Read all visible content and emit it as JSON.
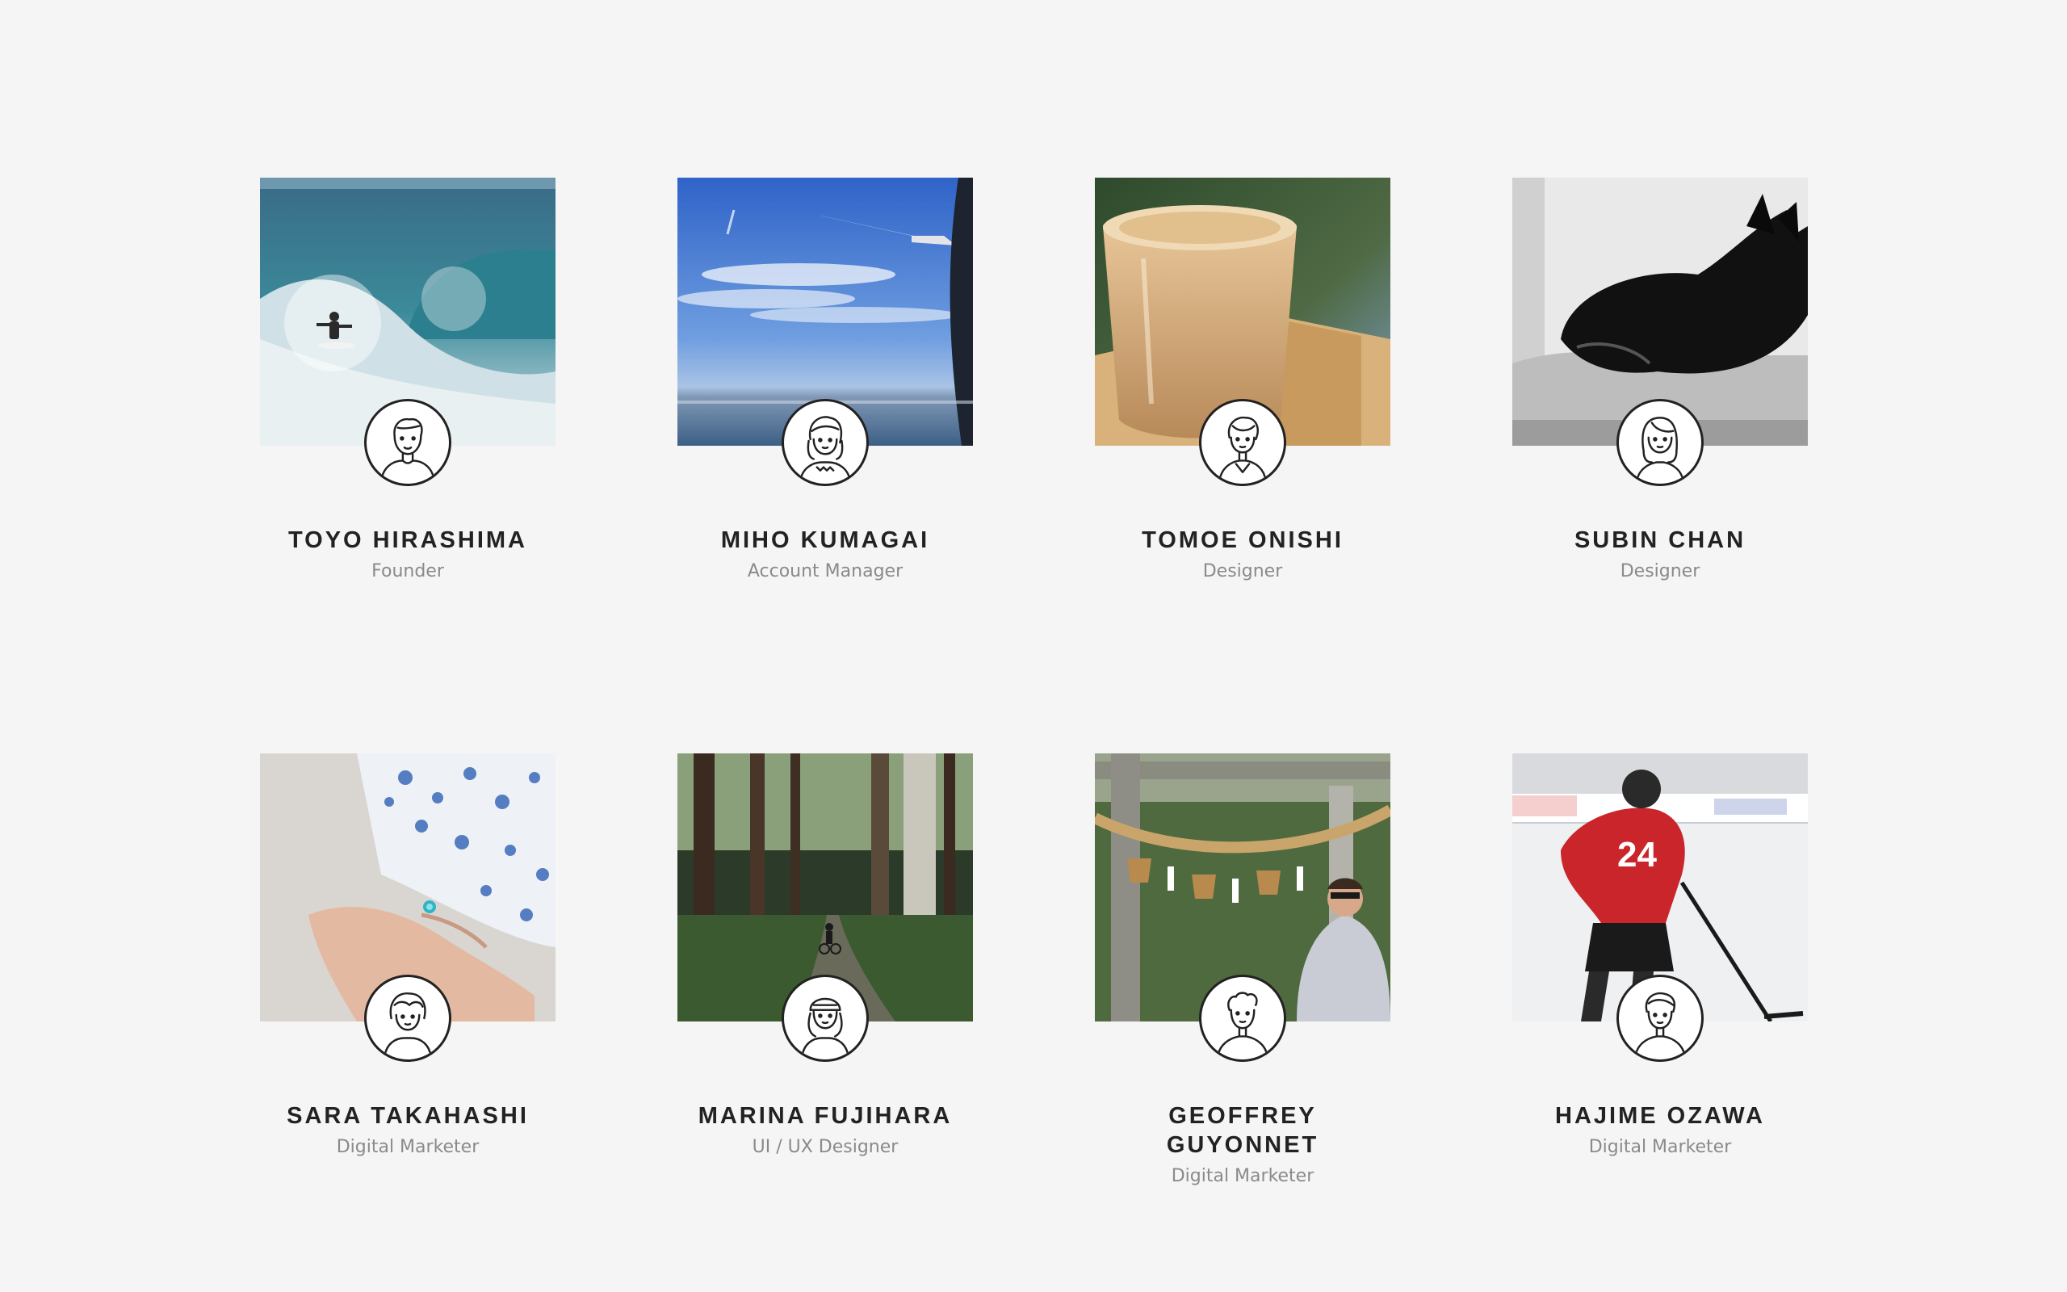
{
  "team": {
    "members": [
      {
        "name": "TOYO HIRASHIMA",
        "role": "Founder",
        "photo": "surfing-wave-photo",
        "avatar": "man-short-hair-avatar-icon"
      },
      {
        "name": "MIHO KUMAGAI",
        "role": "Account Manager",
        "photo": "airplane-window-sky-photo",
        "avatar": "woman-bangs-avatar-icon"
      },
      {
        "name": "TOMOE ONISHI",
        "role": "Designer",
        "photo": "sake-glass-masu-photo",
        "avatar": "woman-short-hair-avatar-icon"
      },
      {
        "name": "SUBIN CHAN",
        "role": "Designer",
        "photo": "black-dog-bw-photo",
        "avatar": "woman-long-hair-avatar-icon"
      },
      {
        "name": "SARA TAKAHASHI",
        "role": "Digital Marketer",
        "photo": "hand-ring-fabric-photo",
        "avatar": "woman-wavy-hair-avatar-icon"
      },
      {
        "name": "MARINA FUJIHARA",
        "role": "UI / UX Designer",
        "photo": "forest-path-cyclist-photo",
        "avatar": "woman-beanie-avatar-icon"
      },
      {
        "name": "GEOFFREY GUYONNET",
        "role": "Digital Marketer",
        "photo": "shrine-torii-rope-photo",
        "avatar": "man-curly-hair-avatar-icon"
      },
      {
        "name": "HAJIME OZAWA",
        "role": "Digital Marketer",
        "photo": "ice-hockey-player-photo",
        "avatar": "man-swept-hair-avatar-icon"
      }
    ]
  },
  "colors": {
    "background": "#f5f5f5",
    "name_text": "#222222",
    "role_text": "#8a8a8a",
    "avatar_border": "#222222"
  }
}
